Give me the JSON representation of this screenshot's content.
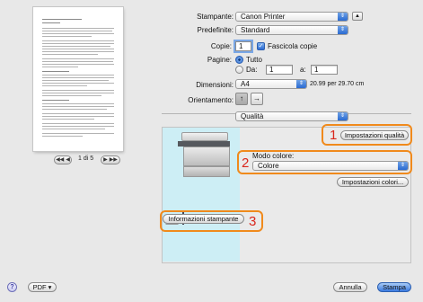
{
  "preview": {
    "page_label": "1 di 5",
    "nav_first": "◀◀",
    "nav_prev": "◀",
    "nav_next": "▶",
    "nav_last": "▶▶"
  },
  "settings": {
    "printer_label": "Stampante:",
    "printer_value": "Canon Printer",
    "preset_label": "Predefinite:",
    "preset_value": "Standard",
    "copies_label": "Copie:",
    "copies_value": "1",
    "collate_label": "Fascicola copie",
    "pages_label": "Pagine:",
    "pages_all": "Tutto",
    "pages_from": "Da:",
    "pages_from_value": "1",
    "pages_to": "a:",
    "pages_to_value": "1",
    "size_label": "Dimensioni:",
    "size_value": "A4",
    "size_dims": "20.99 per 29.70 cm",
    "orientation_label": "Orientamento:",
    "orientation_portrait": "↑",
    "orientation_landscape": "→",
    "section_value": "Qualità"
  },
  "quality": {
    "quality_settings_button": "Impostazioni qualità",
    "color_mode_label": "Modo colore:",
    "color_mode_value": "Colore",
    "color_settings_button": "Impostazioni colori...",
    "printer_info_button": "Informazioni stampante",
    "callouts": [
      "1",
      "2",
      "3"
    ]
  },
  "footer": {
    "help": "?",
    "pdf_button": "PDF ▾",
    "cancel_button": "Annulla",
    "print_button": "Stampa"
  },
  "colors": {
    "accent": "#3b7be0",
    "callout_border": "#f08a1c",
    "callout_number": "#d9261c",
    "panel_sky": "#cdeef5"
  }
}
